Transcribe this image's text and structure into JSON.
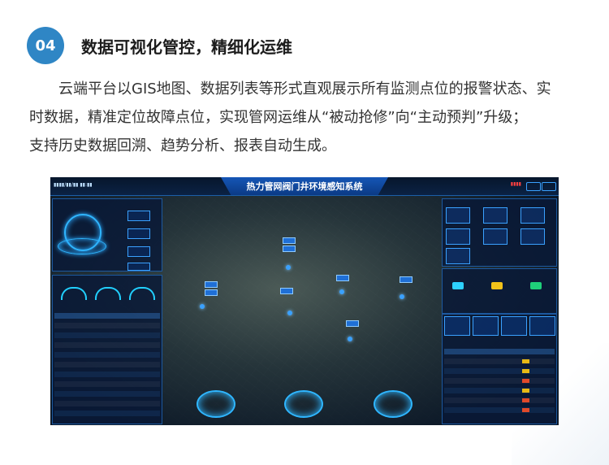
{
  "section": {
    "number": "04",
    "heading": "数据可视化管控，精细化运维",
    "paragraph_lines": [
      "云端平台以GIS地图、数据列表等形式直观展示所有监测点位的报警状态、实",
      "时数据，精准定位故障点位，实现管网运维从“被动抢修”向“主动预判”升级；",
      "支持历史数据回溯、趋势分析、报表自动生成。"
    ]
  },
  "screenshot": {
    "system_title": "热力管网阀门井环境感知系统",
    "colors": {
      "badge": "#2f86c5",
      "screen_bg": "#0d1d30",
      "accent": "#3aa1ff",
      "title_plate": "#1556b6"
    }
  }
}
